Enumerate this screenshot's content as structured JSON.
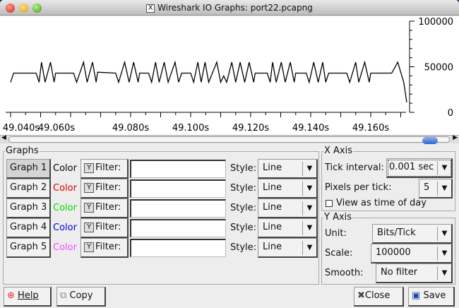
{
  "window": {
    "title": "Wireshark IO Graphs: port22.pcapng"
  },
  "chart_data": {
    "type": "line",
    "x_origin_s": 49.04,
    "x_unit": "ms offset from x_origin_s",
    "x_ticks": [
      "49.040s",
      "49.060s",
      "49.080s",
      "49.100s",
      "49.120s",
      "49.140s",
      "49.160s"
    ],
    "y_ticks": [
      "100000",
      "50000",
      "0"
    ],
    "ylim": [
      0,
      100000
    ],
    "xlim_ms": [
      0,
      130
    ],
    "series": [
      {
        "name": "Graph 1",
        "color": "#000000",
        "points": [
          [
            0,
            33000
          ],
          [
            1,
            43000
          ],
          [
            8.5,
            43000
          ],
          [
            9.5,
            33000
          ],
          [
            10.3,
            55000
          ],
          [
            11.5,
            33000
          ],
          [
            13.3,
            55000
          ],
          [
            14.5,
            33000
          ],
          [
            15,
            43000
          ],
          [
            21,
            43000
          ],
          [
            22,
            33000
          ],
          [
            24.3,
            55000
          ],
          [
            25.5,
            33000
          ],
          [
            27.3,
            55000
          ],
          [
            28.5,
            33000
          ],
          [
            29,
            44000
          ],
          [
            35,
            43000
          ],
          [
            36,
            33000
          ],
          [
            38,
            55000
          ],
          [
            39.5,
            33000
          ],
          [
            41,
            55000
          ],
          [
            42.5,
            33000
          ],
          [
            43,
            43000
          ],
          [
            46,
            43000
          ],
          [
            47,
            33000
          ],
          [
            48.3,
            55000
          ],
          [
            49.5,
            33000
          ],
          [
            51.2,
            55000
          ],
          [
            52.5,
            33000
          ],
          [
            54.8,
            55000
          ],
          [
            56,
            33000
          ],
          [
            57,
            43000
          ],
          [
            60,
            43000
          ],
          [
            61,
            33000
          ],
          [
            62.4,
            55000
          ],
          [
            63.5,
            33000
          ],
          [
            64.8,
            55000
          ],
          [
            66,
            33000
          ],
          [
            68.7,
            55000
          ],
          [
            70,
            33000
          ],
          [
            71,
            40000
          ],
          [
            72,
            33000
          ],
          [
            73.7,
            55000
          ],
          [
            75,
            33000
          ],
          [
            76.5,
            55000
          ],
          [
            78,
            33000
          ],
          [
            79.5,
            55000
          ],
          [
            81,
            33000
          ],
          [
            81.5,
            43000
          ],
          [
            85.5,
            43000
          ],
          [
            86.5,
            33000
          ],
          [
            87.3,
            55000
          ],
          [
            88.5,
            33000
          ],
          [
            90.2,
            55000
          ],
          [
            91.5,
            33000
          ],
          [
            93.2,
            55000
          ],
          [
            94.5,
            33000
          ],
          [
            95,
            43000
          ],
          [
            98.5,
            43000
          ],
          [
            99.5,
            33000
          ],
          [
            101,
            55000
          ],
          [
            102.5,
            33000
          ],
          [
            104,
            55000
          ],
          [
            105,
            33000
          ],
          [
            106,
            43000
          ],
          [
            112,
            43000
          ],
          [
            113,
            33000
          ],
          [
            115,
            55000
          ],
          [
            116,
            33000
          ],
          [
            118,
            55000
          ],
          [
            119.5,
            33000
          ],
          [
            120,
            43000
          ],
          [
            127,
            43000
          ],
          [
            129,
            55000
          ],
          [
            131,
            33000
          ],
          [
            132,
            11000
          ]
        ]
      }
    ]
  },
  "graphs": {
    "legend": "Graphs",
    "color_label": "Color",
    "filter_label": "Filter:",
    "style_label": "Style:",
    "rows": [
      {
        "label": "Graph 1",
        "color": "#000000",
        "filter": "",
        "style": "Line"
      },
      {
        "label": "Graph 2",
        "color": "#e00000",
        "filter": "",
        "style": "Line"
      },
      {
        "label": "Graph 3",
        "color": "#00dd00",
        "filter": "",
        "style": "Line"
      },
      {
        "label": "Graph 4",
        "color": "#0000dd",
        "filter": "",
        "style": "Line"
      },
      {
        "label": "Graph 5",
        "color": "#ff44ff",
        "filter": "",
        "style": "Line"
      }
    ]
  },
  "x_axis": {
    "legend": "X Axis",
    "tick_interval_label": "Tick interval:",
    "tick_interval": "0.001 sec",
    "pixels_label": "Pixels per tick:",
    "pixels": "5",
    "time_of_day_label": "View as time of day"
  },
  "y_axis": {
    "legend": "Y Axis",
    "unit_label": "Unit:",
    "unit": "Bits/Tick",
    "scale_label": "Scale:",
    "scale": "100000",
    "smooth_label": "Smooth:",
    "smooth": "No filter"
  },
  "buttons": {
    "help": "Help",
    "copy": "Copy",
    "close": "Close",
    "save": "Save"
  }
}
